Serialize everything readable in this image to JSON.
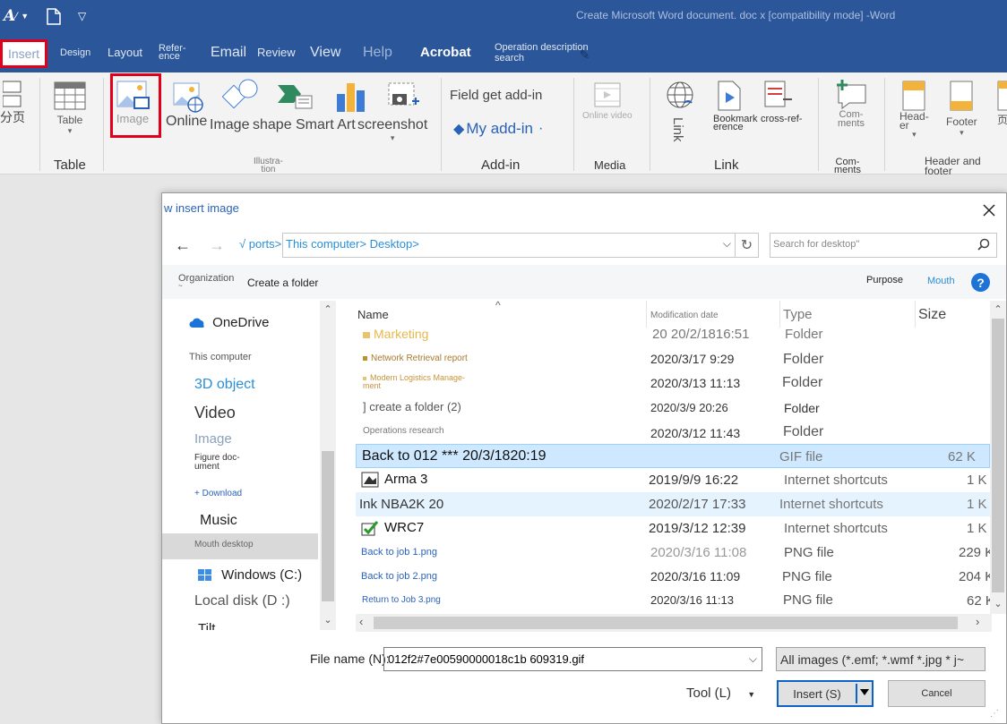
{
  "title_bar": {
    "doc_title": "Create Microsoft Word document. doc x [compatibility mode] -Word"
  },
  "tabs": [
    {
      "label": "Insert",
      "active": true
    },
    {
      "label": "Design"
    },
    {
      "label": "Layout"
    },
    {
      "label": "Refer-\nence"
    },
    {
      "label": "Email"
    },
    {
      "label": "Review"
    },
    {
      "label": "View"
    },
    {
      "label": "Help"
    },
    {
      "label": "Acrobat"
    },
    {
      "label": "Operation description\nsearch"
    }
  ],
  "ribbon": {
    "page_label": "分页",
    "table_btn": "Table",
    "table_group": "Table",
    "image_btn": "Image",
    "online_btn": "Online",
    "image2_btn": "Image",
    "shape_btn": "shape",
    "smartart_btn": "Smart Art",
    "screenshot_btn": "screenshot",
    "illus_group": "Illustra-\ntion",
    "field_get": "Field get add-in",
    "my_addin": "My add-in",
    "addin_group": "Add-in",
    "online_video": "Online video",
    "media_group": "Media",
    "link_btn": "Link",
    "bookmark_btn": "Bookmark\nerence",
    "crossref_btn": "cross-ref-",
    "link_group": "Link",
    "comments_btn": "Com-\nments",
    "comments_group": "Com-\nments",
    "header_btn": "Head-\ner",
    "footer_btn": "Footer",
    "hf_group": "Header and\nfooter",
    "page_num": "页"
  },
  "dialog": {
    "title": "w insert image",
    "nav": {
      "crumb_prefix": "√ ports>",
      "address": "This computer> Desktop>",
      "search_placeholder": "Search for desktop\""
    },
    "toolbar": {
      "organization": "Organization",
      "new_folder": "Create a folder",
      "purpose": "Purpose",
      "mouth": "Mouth",
      "help": "?"
    },
    "sidebar": [
      {
        "label": "OneDrive"
      },
      {
        "label": "This computer"
      },
      {
        "label": "3D object"
      },
      {
        "label": "Video"
      },
      {
        "label": "Image"
      },
      {
        "label": "Figure doc-\nument"
      },
      {
        "label": "+ Download"
      },
      {
        "label": "Music"
      },
      {
        "label": "Mouth desktop",
        "selected": true
      },
      {
        "label": "Windows (C:)"
      },
      {
        "label": "Local disk (D :)"
      },
      {
        "label": "Tilt"
      }
    ],
    "columns": {
      "name": "Name",
      "date": "Modification date",
      "type": "Type",
      "size": "Size"
    },
    "files": [
      {
        "name": "Marketing",
        "date": "20 20/2/1816:51",
        "type": "Folder",
        "size": ""
      },
      {
        "name": "Network Retrieval report",
        "date": "2020/3/17 9:29",
        "type": "Folder",
        "size": ""
      },
      {
        "name": "Modern Logistics Manage-\nment",
        "date": "2020/3/13 11:13",
        "type": "Folder",
        "size": ""
      },
      {
        "name": "] create a folder (2)",
        "date": "2020/3/9 20:26",
        "type": "Folder",
        "size": ""
      },
      {
        "name": "Operations research",
        "date": "2020/3/12 11:43",
        "type": "Folder",
        "size": ""
      },
      {
        "name": "Back to 012 *** 20/3/1820:19",
        "date": "",
        "type": "GIF file",
        "size": "62 K",
        "selected": true
      },
      {
        "name": "Arma 3",
        "date": "2019/9/9 16:22",
        "type": "Internet shortcuts",
        "size": "1 K"
      },
      {
        "name": "Ink NBA2K 20",
        "date": "2020/2/17 17:33",
        "type": "Internet shortcuts",
        "size": "1 K",
        "hover": true
      },
      {
        "name": "WRC7",
        "date": "2019/3/12 12:39",
        "type": "Internet shortcuts",
        "size": "1 K"
      },
      {
        "name": "Back to job 1.png",
        "date": "2020/3/16 11:08",
        "type": "PNG file",
        "size": "229 K"
      },
      {
        "name": "Back to job 2.png",
        "date": "2020/3/16 11:09",
        "type": "PNG file",
        "size": "204 K"
      },
      {
        "name": "Return to Job 3.png",
        "date": "2020/3/16 11:13",
        "type": "PNG file",
        "size": "62 K"
      }
    ],
    "file_name_label": "File name (N):",
    "file_name_value": "012f2#7e00590000018c1b 609319.gif",
    "filter": "All images (*.emf; *.wmf *.jpg * j~",
    "tool": "Tool (L)",
    "insert": "Insert (S)",
    "cancel": "Cancel"
  },
  "colors": {
    "ribbon_blue": "#2b579a",
    "highlight_red": "#e0001a",
    "link_blue": "#2a8fd6",
    "selection": "#cde8ff"
  }
}
